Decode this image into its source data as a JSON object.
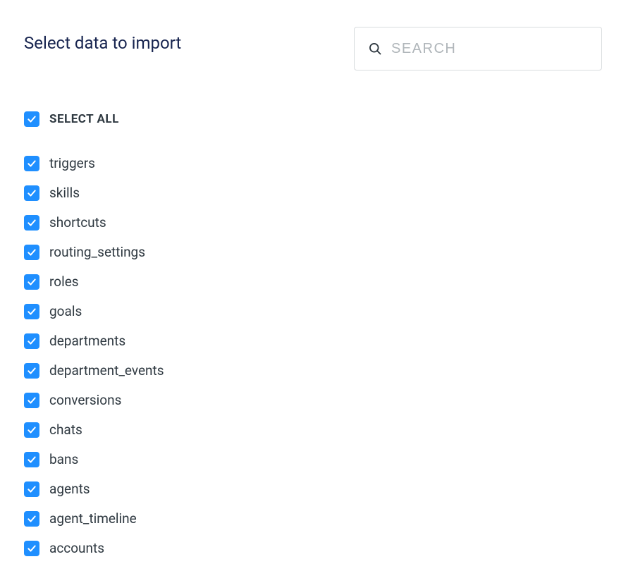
{
  "header": {
    "title": "Select data to import",
    "search_placeholder": "SEARCH"
  },
  "select_all": {
    "label": "SELECT ALL",
    "checked": true
  },
  "items": [
    {
      "label": "triggers",
      "checked": true
    },
    {
      "label": "skills",
      "checked": true
    },
    {
      "label": "shortcuts",
      "checked": true
    },
    {
      "label": "routing_settings",
      "checked": true
    },
    {
      "label": "roles",
      "checked": true
    },
    {
      "label": "goals",
      "checked": true
    },
    {
      "label": "departments",
      "checked": true
    },
    {
      "label": "department_events",
      "checked": true
    },
    {
      "label": "conversions",
      "checked": true
    },
    {
      "label": "chats",
      "checked": true
    },
    {
      "label": "bans",
      "checked": true
    },
    {
      "label": "agents",
      "checked": true
    },
    {
      "label": "agent_timeline",
      "checked": true
    },
    {
      "label": "accounts",
      "checked": true
    }
  ]
}
